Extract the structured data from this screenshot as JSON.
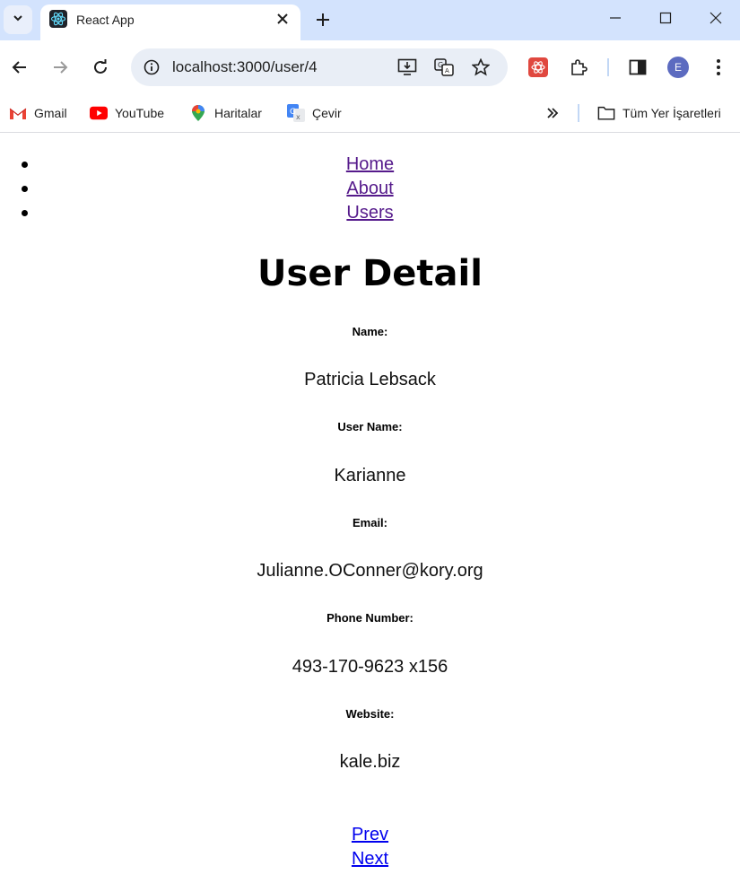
{
  "browser": {
    "tab_title": "React App",
    "url": "localhost:3000/user/4",
    "profile_initial": "E",
    "bookmarks": [
      "Gmail",
      "YouTube",
      "Haritalar",
      "Çevir"
    ],
    "all_bookmarks_label": "Tüm Yer İşaretleri"
  },
  "nav": {
    "items": [
      "Home",
      "About",
      "Users"
    ]
  },
  "page": {
    "title": "User Detail",
    "fields": [
      {
        "label": "Name:",
        "value": "Patricia Lebsack"
      },
      {
        "label": "User Name:",
        "value": "Karianne"
      },
      {
        "label": "Email:",
        "value": "Julianne.OConner@kory.org"
      },
      {
        "label": "Phone Number:",
        "value": "493-170-9623 x156"
      },
      {
        "label": "Website:",
        "value": "kale.biz"
      }
    ],
    "prev_label": "Prev",
    "next_label": "Next"
  }
}
